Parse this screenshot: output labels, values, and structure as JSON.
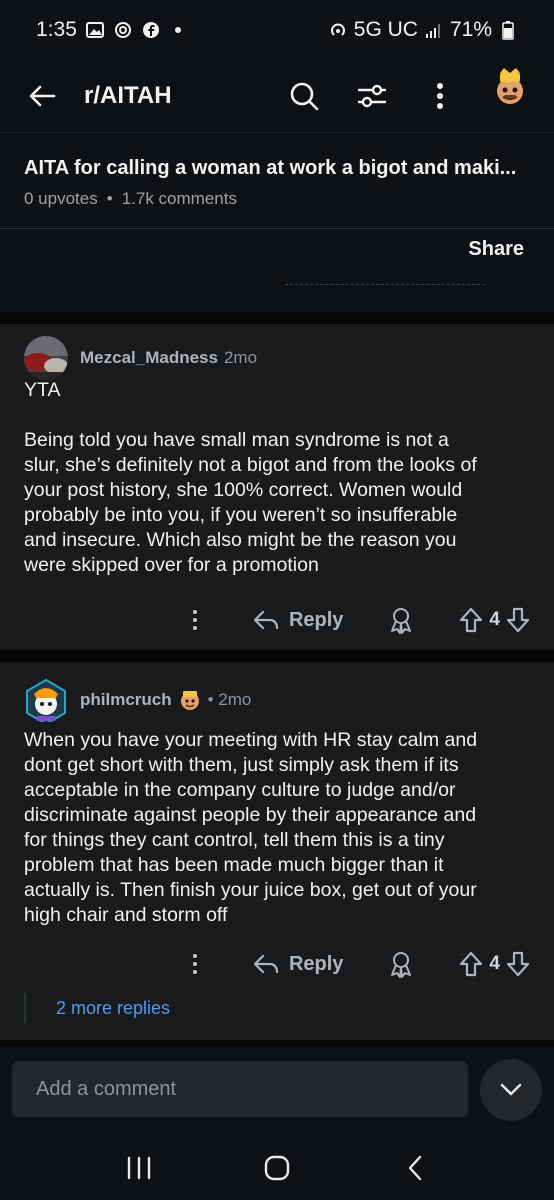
{
  "status_bar": {
    "time": "1:35",
    "network": "5G UC",
    "battery": "71%"
  },
  "header": {
    "title": "r/AITAH",
    "icons": [
      "back-arrow-icon",
      "search-icon",
      "filter-icon",
      "more-vertical-icon",
      "user-avatar"
    ]
  },
  "post": {
    "title": "AITA for calling a woman at work a bigot and maki...",
    "upvotes": "0 upvotes",
    "separator": "•",
    "comments": "1.7k comments",
    "share_label": "Share"
  },
  "comments": [
    {
      "username": "Mezcal_Madness",
      "time": "2mo",
      "body": [
        "YTA",
        "",
        "Being told you have small man syndrome is not a",
        "slur, she’s definitely not a bigot and from the looks of",
        "your post history, she 100% correct. Women would",
        "probably be into you, if you weren’t so insufferable",
        "and insecure. Which also might be the reason you",
        "were skipped over for a promotion"
      ],
      "reply_label": "Reply",
      "votes": "4"
    },
    {
      "username": "philmcruch",
      "time": "• 2mo",
      "body": [
        "When you have your meeting with HR stay calm and",
        "dont get short with them, just simply ask them if its",
        "acceptable in the company culture to judge and/or",
        "discriminate against people by their appearance and",
        "for things they cant control, tell them this is a tiny",
        "problem that has been made much bigger than it",
        "actually is. Then finish your juice box, get out of your",
        "high chair and storm off"
      ],
      "reply_label": "Reply",
      "votes": "4"
    }
  ],
  "more_replies": "2 more replies",
  "composer": {
    "placeholder": "Add a comment"
  },
  "colors": {
    "background": "#0e1113",
    "comment_bg": "#181a1c",
    "link": "#4e9cf0",
    "muted": "#9aa3a8"
  }
}
